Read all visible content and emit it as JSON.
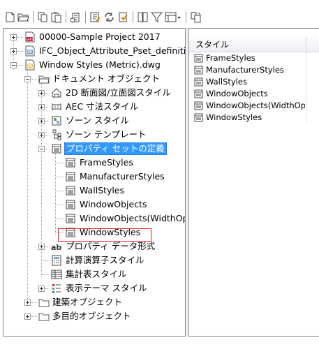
{
  "toolbar": {
    "buttons": [
      {
        "name": "new-icon"
      },
      {
        "name": "open-folder-icon"
      },
      {
        "name": "copy-icon"
      },
      {
        "name": "paste-icon"
      },
      {
        "name": "purge-icon"
      },
      {
        "name": "edit-style-icon"
      },
      {
        "name": "synchronize-icon"
      },
      {
        "name": "clean-icon"
      },
      {
        "name": "window-icon"
      },
      {
        "name": "filter-icon"
      },
      {
        "name": "view-mode-icon"
      },
      {
        "name": "dropdown-arrow-icon"
      },
      {
        "name": "toggle-view-icon"
      }
    ]
  },
  "tree": {
    "items": [
      {
        "label": "00000-Sample Project 2017"
      },
      {
        "label": "IFC_Object_Attribute_Pset_definiti"
      },
      {
        "label": "Window Styles (Metric).dwg"
      },
      {
        "label": "ドキュメント オブジェクト"
      },
      {
        "label": "2D 断面図/立面図スタイル"
      },
      {
        "label": "AEC 寸法スタイル"
      },
      {
        "label": "ゾーン スタイル"
      },
      {
        "label": "ゾーン テンプレート"
      },
      {
        "label": "プロパティ セットの定義"
      },
      {
        "label": "FrameStyles"
      },
      {
        "label": "ManufacturerStyles"
      },
      {
        "label": "WallStyles"
      },
      {
        "label": "WindowObjects"
      },
      {
        "label": "WindowObjects(WidthOpt"
      },
      {
        "label": "WindowStyles"
      },
      {
        "label": "プロパティ データ形式"
      },
      {
        "label": "計算演算子スタイル"
      },
      {
        "label": "集計表スタイル"
      },
      {
        "label": "表示テーマ スタイル"
      },
      {
        "label": "建築オブジェクト"
      },
      {
        "label": "多目的オブジェクト"
      }
    ]
  },
  "list": {
    "header": "スタイル",
    "rows": [
      {
        "label": "FrameStyles"
      },
      {
        "label": "ManufacturerStyles"
      },
      {
        "label": "WallStyles"
      },
      {
        "label": "WindowObjects"
      },
      {
        "label": "WindowObjects(WidthOptio..."
      },
      {
        "label": "WindowStyles"
      }
    ]
  },
  "colors": {
    "selection": "#3399ff",
    "highlight_box": "#e0261e",
    "folder": "#e8c96b"
  }
}
